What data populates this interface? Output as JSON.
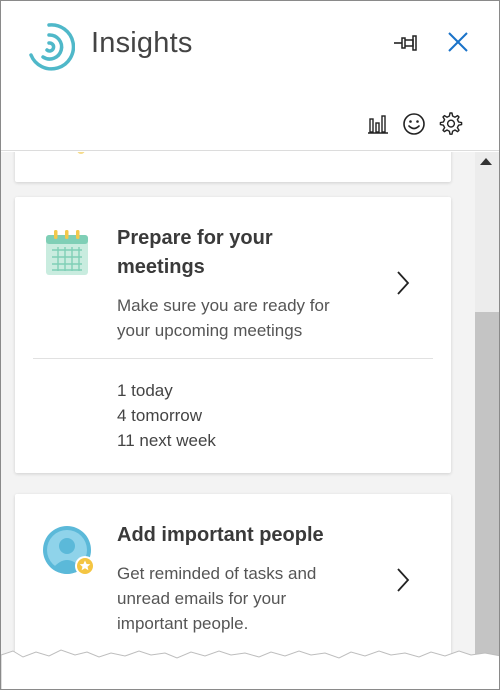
{
  "header": {
    "title": "Insights",
    "icons": {
      "logo": "insights-logo",
      "pin": "pin-icon",
      "close": "close-icon",
      "stats": "bar-chart-icon",
      "feedback": "smiley-icon",
      "settings": "gear-icon"
    }
  },
  "cards": {
    "meetings": {
      "icon": "calendar-icon",
      "title_line1": "Prepare for your",
      "title_line2": "meetings",
      "desc_line1": "Make sure you are ready for",
      "desc_line2": "your upcoming meetings",
      "stats": [
        "1 today",
        "4 tomorrow",
        "11 next week"
      ]
    },
    "people": {
      "icon": "person-star-icon",
      "title": "Add important people",
      "desc_line1": "Get reminded of tasks and",
      "desc_line2": "unread emails for your",
      "desc_line3": "important people."
    }
  },
  "colors": {
    "accent": "#1a73c9",
    "logo": "#4fb8c9",
    "calendar_body": "#c9ecdf",
    "calendar_top": "#7fcfb6",
    "calendar_rings": "#f2c94c",
    "avatar_bg": "#5bb9d9",
    "star_badge": "#f4c542"
  }
}
